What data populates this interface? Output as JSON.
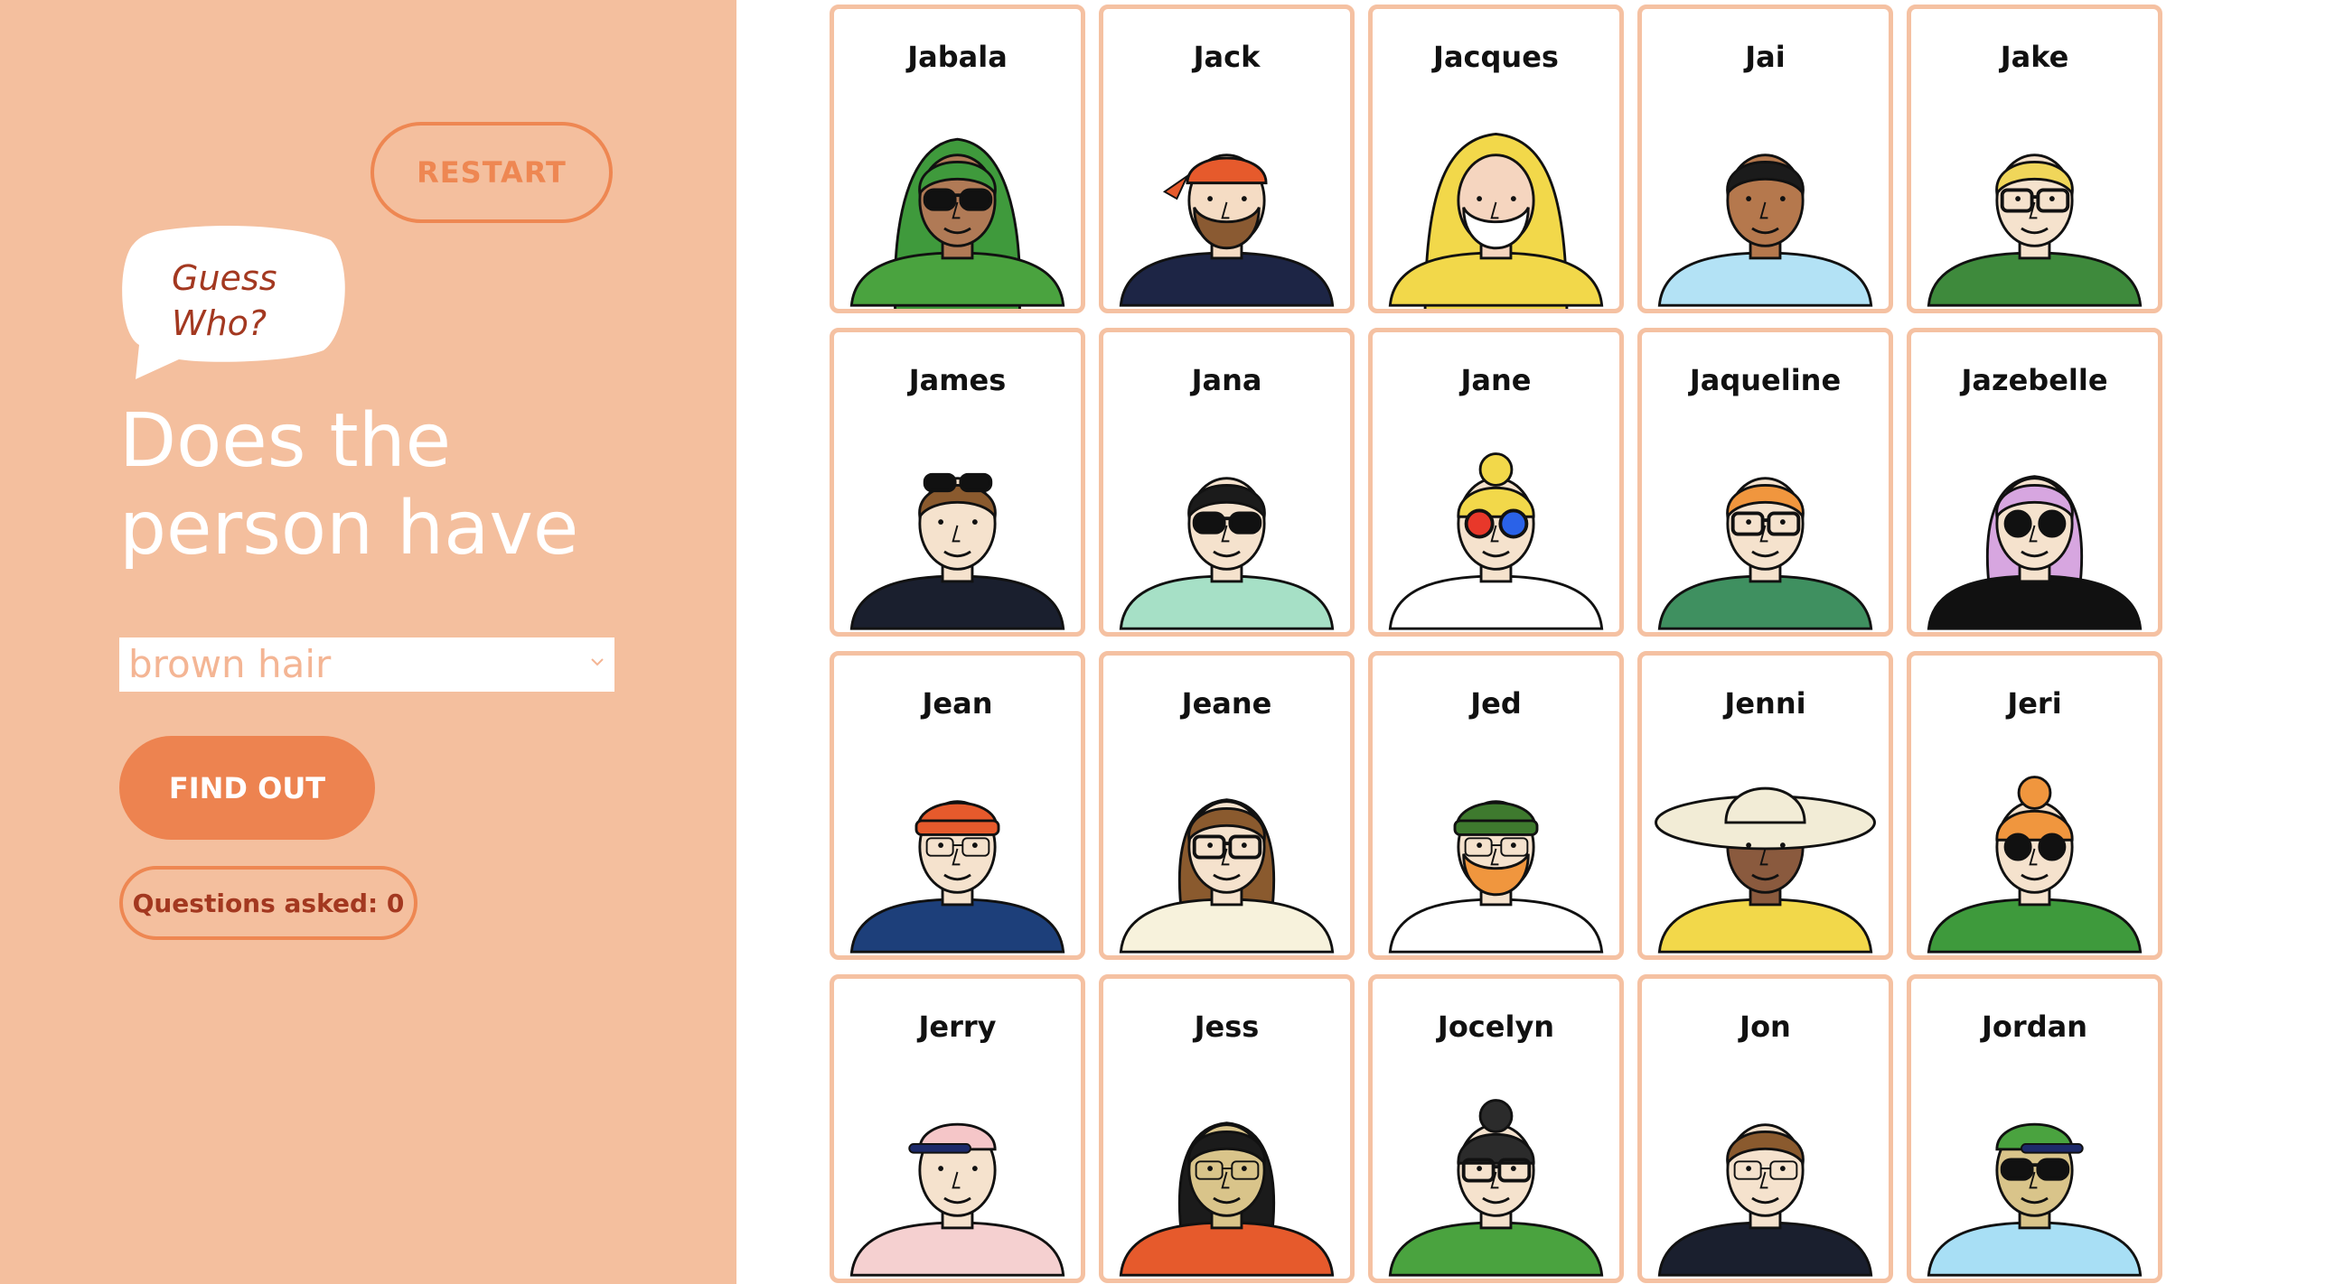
{
  "sidebar": {
    "restart_label": "RESTART",
    "bubble_line1": "Guess",
    "bubble_line2": "Who?",
    "heading_line1": "Does the",
    "heading_line2": "person have",
    "select_value": "brown hair",
    "find_out_label": "FIND OUT",
    "questions_asked": "Questions asked: 0"
  },
  "colors": {
    "sidebar_bg": "#f4bf9e",
    "accent": "#ed8350",
    "dark_accent": "#a33820",
    "card_border": "#f5c1a2"
  },
  "characters": [
    {
      "name": "Jabala",
      "hair": "#3f9a3c",
      "skin": "#b07a56",
      "shirt": "#4aa33f",
      "glasses": "sunglasses",
      "hat": "none",
      "hood": "#3f9a3c"
    },
    {
      "name": "Jack",
      "hair": "#e65a2c",
      "skin": "#f5dcc4",
      "shirt": "#1d2545",
      "glasses": "none",
      "hat": "bandana",
      "beard": "#8a5a32"
    },
    {
      "name": "Jacques",
      "hair": "#f2d84a",
      "skin": "#f5d5bf",
      "shirt": "#f2d84a",
      "glasses": "none",
      "hat": "hood",
      "beard": "#ffffff"
    },
    {
      "name": "Jai",
      "hair": "#1b1b1b",
      "skin": "#b5784d",
      "shirt": "#b3e2f5",
      "glasses": "none",
      "hat": "none"
    },
    {
      "name": "Jake",
      "hair": "#f0d65a",
      "skin": "#f5e2cd",
      "shirt": "#3e8a3c",
      "glasses": "thick",
      "hat": "none"
    },
    {
      "name": "James",
      "hair": "#8a5a2e",
      "skin": "#f5e2cd",
      "shirt": "#1a1f2e",
      "glasses": "sunglasses-on-head",
      "hat": "none"
    },
    {
      "name": "Jana",
      "hair": "#1b1b1b",
      "skin": "#f5e2cd",
      "shirt": "#a6e0c6",
      "glasses": "sunglasses",
      "hat": "none"
    },
    {
      "name": "Jane",
      "hair": "#f2d84a",
      "skin": "#f5e2cd",
      "shirt": "#ffffff",
      "glasses": "3d",
      "hat": "bun"
    },
    {
      "name": "Jaqueline",
      "hair": "#f0963e",
      "skin": "#f5e2cd",
      "shirt": "#3f9060",
      "glasses": "thick",
      "hat": "none"
    },
    {
      "name": "Jazebelle",
      "hair": "#d7a6e0",
      "skin": "#f5e2cd",
      "shirt": "#111111",
      "glasses": "round-dark",
      "hat": "none"
    },
    {
      "name": "Jean",
      "hair": "#e65a2c",
      "skin": "#f5e2cd",
      "shirt": "#1d3f7a",
      "glasses": "thin",
      "hat": "beanie"
    },
    {
      "name": "Jeane",
      "hair": "#8a5a2e",
      "skin": "#f5e2cd",
      "shirt": "#f7f2dc",
      "glasses": "thick",
      "hat": "none"
    },
    {
      "name": "Jed",
      "hair": "#3e7a2e",
      "skin": "#f5e2cd",
      "shirt": "#ffffff",
      "glasses": "thin",
      "hat": "beanie",
      "beard": "#f0963e"
    },
    {
      "name": "Jenni",
      "hair": "#f2ecd6",
      "skin": "#8a5a3e",
      "shirt": "#f2d84a",
      "glasses": "none",
      "hat": "sunhat"
    },
    {
      "name": "Jeri",
      "hair": "#f0963e",
      "skin": "#f5e2cd",
      "shirt": "#3e9a3c",
      "glasses": "round-dark",
      "hat": "bun"
    },
    {
      "name": "Jerry",
      "hair": "#f5c6c8",
      "skin": "#f5e2cd",
      "shirt": "#f5d0d0",
      "glasses": "none",
      "hat": "cap"
    },
    {
      "name": "Jess",
      "hair": "#1b1b1b",
      "skin": "#d9c48a",
      "shirt": "#e65a2c",
      "glasses": "thin",
      "hat": "none"
    },
    {
      "name": "Jocelyn",
      "hair": "#2b2b2b",
      "skin": "#f5e2cd",
      "shirt": "#4aa33f",
      "glasses": "thick",
      "hat": "bun"
    },
    {
      "name": "Jon",
      "hair": "#8a5a2e",
      "skin": "#f5e2cd",
      "shirt": "#1a1f2e",
      "glasses": "thin",
      "hat": "none"
    },
    {
      "name": "Jordan",
      "hair": "#f2d84a",
      "skin": "#d9c48a",
      "shirt": "#a8dff5",
      "glasses": "sunglasses",
      "hat": "cap-green"
    }
  ]
}
